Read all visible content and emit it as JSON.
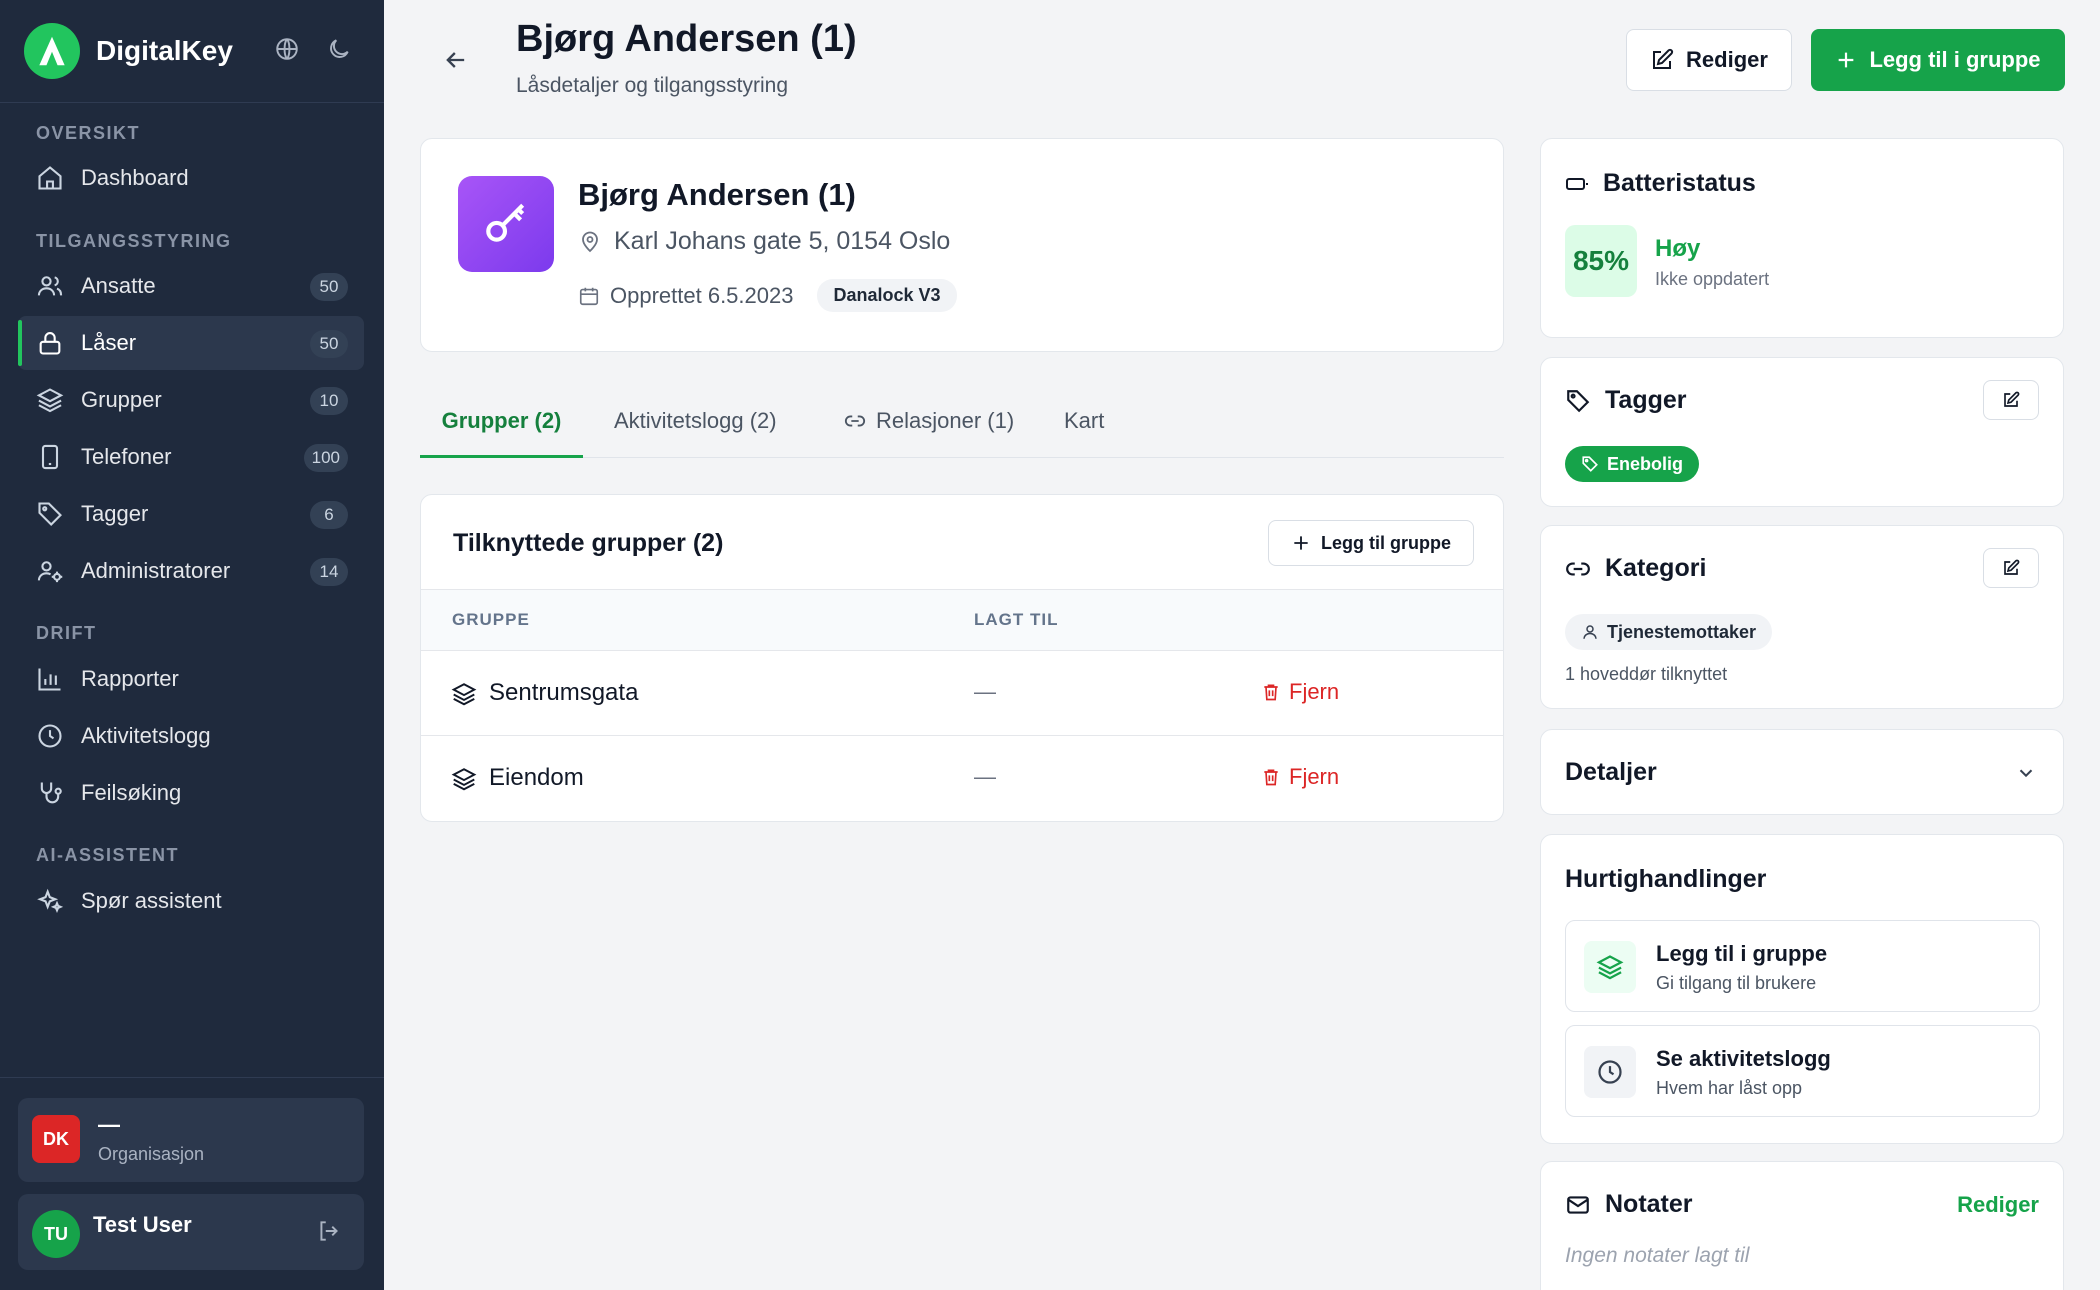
{
  "app": {
    "name": "DigitalKey"
  },
  "sidebar": {
    "sections": [
      {
        "label": "OVERSIKT"
      },
      {
        "label": "TILGANGSSTYRING"
      },
      {
        "label": "DRIFT"
      },
      {
        "label": "AI-ASSISTENT"
      }
    ],
    "items": [
      {
        "label": "Dashboard",
        "icon": "home-icon"
      },
      {
        "label": "Ansatte",
        "badge": "50",
        "icon": "users-icon"
      },
      {
        "label": "Låser",
        "badge": "50",
        "icon": "lock-icon",
        "active": true
      },
      {
        "label": "Grupper",
        "badge": "10",
        "icon": "layers-icon"
      },
      {
        "label": "Telefoner",
        "badge": "100",
        "icon": "phone-icon"
      },
      {
        "label": "Tagger",
        "badge": "6",
        "icon": "tag-icon"
      },
      {
        "label": "Administratorer",
        "badge": "14",
        "icon": "user-cog-icon"
      },
      {
        "label": "Rapporter",
        "icon": "bar-chart-icon"
      },
      {
        "label": "Aktivitetslogg",
        "icon": "clock-icon"
      },
      {
        "label": "Feilsøking",
        "icon": "stethoscope-icon"
      },
      {
        "label": "Spør assistent",
        "icon": "sparkles-icon"
      }
    ],
    "org": {
      "initials": "DK",
      "name": "—",
      "sub": "Organisasjon"
    },
    "user": {
      "initials": "TU",
      "name": "Test User"
    }
  },
  "header": {
    "title": "Bjørg Andersen (1)",
    "subtitle": "Låsdetaljer og tilgangsstyring",
    "edit_label": "Rediger",
    "add_label": "Legg til i gruppe"
  },
  "lock": {
    "name": "Bjørg Andersen (1)",
    "address": "Karl Johans gate 5, 0154 Oslo",
    "created": "Opprettet 6.5.2023",
    "model": "Danalock V3"
  },
  "tabs": [
    {
      "label": "Grupper (2)",
      "active": true
    },
    {
      "label": "Aktivitetslogg (2)"
    },
    {
      "label": "Relasjoner (1)"
    },
    {
      "label": "Kart"
    }
  ],
  "groups": {
    "title": "Tilknyttede grupper (2)",
    "add_label": "Legg til gruppe",
    "columns": [
      "GRUPPE",
      "LAGT TIL"
    ],
    "rows": [
      {
        "name": "Sentrumsgata",
        "added": "—",
        "action": "Fjern"
      },
      {
        "name": "Eiendom",
        "added": "—",
        "action": "Fjern"
      }
    ]
  },
  "battery": {
    "title": "Batteristatus",
    "percent": "85%",
    "level": "Høy",
    "sub": "Ikke oppdatert"
  },
  "tags": {
    "title": "Tagger",
    "items": [
      "Enebolig"
    ]
  },
  "category": {
    "title": "Kategori",
    "value": "Tjenestemottaker",
    "sub": "1 hoveddør tilknyttet"
  },
  "details": {
    "title": "Detaljer"
  },
  "quick": {
    "title": "Hurtighandlinger",
    "items": [
      {
        "title": "Legg til i gruppe",
        "sub": "Gi tilgang til brukere"
      },
      {
        "title": "Se aktivitetslogg",
        "sub": "Hvem har låst opp"
      }
    ]
  },
  "notes": {
    "title": "Notater",
    "edit_label": "Rediger",
    "empty": "Ingen notater lagt til"
  },
  "colors": {
    "accent": "#16a34a",
    "sidebar": "#1f2a3d",
    "danger": "#dc2626",
    "lock_icon": "#8b5cf6"
  }
}
